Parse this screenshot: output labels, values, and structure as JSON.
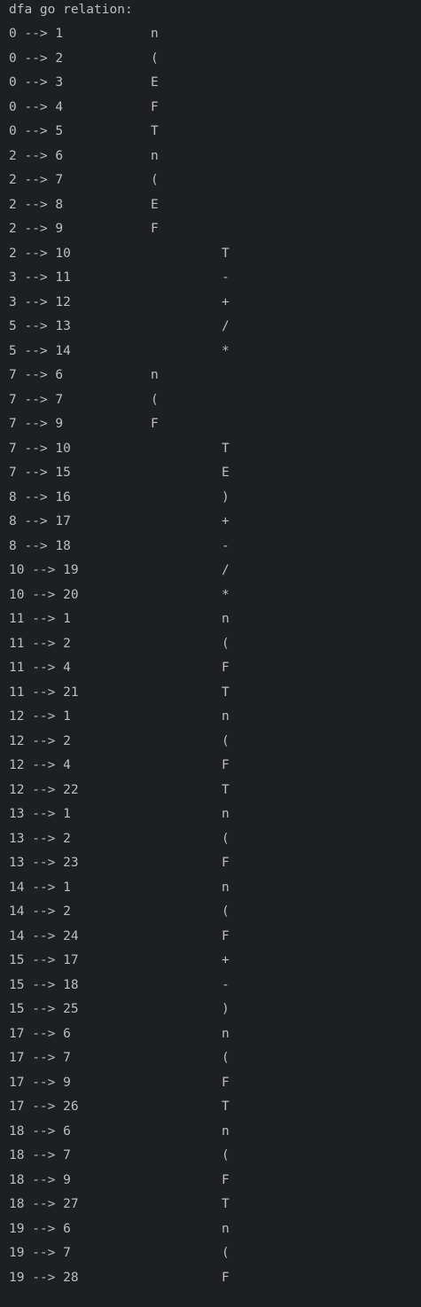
{
  "console": {
    "title": "dfa go relation:",
    "lines": [
      {
        "edge": "0 --> 1",
        "symbol": "n",
        "column": "a"
      },
      {
        "edge": "0 --> 2",
        "symbol": "(",
        "column": "a"
      },
      {
        "edge": "0 --> 3",
        "symbol": "E",
        "column": "a"
      },
      {
        "edge": "0 --> 4",
        "symbol": "F",
        "column": "a"
      },
      {
        "edge": "0 --> 5",
        "symbol": "T",
        "column": "a"
      },
      {
        "edge": "2 --> 6",
        "symbol": "n",
        "column": "a"
      },
      {
        "edge": "2 --> 7",
        "symbol": "(",
        "column": "a"
      },
      {
        "edge": "2 --> 8",
        "symbol": "E",
        "column": "a"
      },
      {
        "edge": "2 --> 9",
        "symbol": "F",
        "column": "a"
      },
      {
        "edge": "2 --> 10",
        "symbol": "T",
        "column": "b"
      },
      {
        "edge": "3 --> 11",
        "symbol": "-",
        "column": "b"
      },
      {
        "edge": "3 --> 12",
        "symbol": "+",
        "column": "b"
      },
      {
        "edge": "5 --> 13",
        "symbol": "/",
        "column": "b"
      },
      {
        "edge": "5 --> 14",
        "symbol": "*",
        "column": "b"
      },
      {
        "edge": "7 --> 6",
        "symbol": "n",
        "column": "a"
      },
      {
        "edge": "7 --> 7",
        "symbol": "(",
        "column": "a"
      },
      {
        "edge": "7 --> 9",
        "symbol": "F",
        "column": "a"
      },
      {
        "edge": "7 --> 10",
        "symbol": "T",
        "column": "b"
      },
      {
        "edge": "7 --> 15",
        "symbol": "E",
        "column": "b"
      },
      {
        "edge": "8 --> 16",
        "symbol": ")",
        "column": "b"
      },
      {
        "edge": "8 --> 17",
        "symbol": "+",
        "column": "b"
      },
      {
        "edge": "8 --> 18",
        "symbol": "-",
        "column": "b"
      },
      {
        "edge": "10 --> 19",
        "symbol": "/",
        "column": "b"
      },
      {
        "edge": "10 --> 20",
        "symbol": "*",
        "column": "b"
      },
      {
        "edge": "11 --> 1",
        "symbol": "n",
        "column": "b"
      },
      {
        "edge": "11 --> 2",
        "symbol": "(",
        "column": "b"
      },
      {
        "edge": "11 --> 4",
        "symbol": "F",
        "column": "b"
      },
      {
        "edge": "11 --> 21",
        "symbol": "T",
        "column": "b"
      },
      {
        "edge": "12 --> 1",
        "symbol": "n",
        "column": "b"
      },
      {
        "edge": "12 --> 2",
        "symbol": "(",
        "column": "b"
      },
      {
        "edge": "12 --> 4",
        "symbol": "F",
        "column": "b"
      },
      {
        "edge": "12 --> 22",
        "symbol": "T",
        "column": "b"
      },
      {
        "edge": "13 --> 1",
        "symbol": "n",
        "column": "b"
      },
      {
        "edge": "13 --> 2",
        "symbol": "(",
        "column": "b"
      },
      {
        "edge": "13 --> 23",
        "symbol": "F",
        "column": "b"
      },
      {
        "edge": "14 --> 1",
        "symbol": "n",
        "column": "b"
      },
      {
        "edge": "14 --> 2",
        "symbol": "(",
        "column": "b"
      },
      {
        "edge": "14 --> 24",
        "symbol": "F",
        "column": "b"
      },
      {
        "edge": "15 --> 17",
        "symbol": "+",
        "column": "b"
      },
      {
        "edge": "15 --> 18",
        "symbol": "-",
        "column": "b"
      },
      {
        "edge": "15 --> 25",
        "symbol": ")",
        "column": "b"
      },
      {
        "edge": "17 --> 6",
        "symbol": "n",
        "column": "b"
      },
      {
        "edge": "17 --> 7",
        "symbol": "(",
        "column": "b"
      },
      {
        "edge": "17 --> 9",
        "symbol": "F",
        "column": "b"
      },
      {
        "edge": "17 --> 26",
        "symbol": "T",
        "column": "b"
      },
      {
        "edge": "18 --> 6",
        "symbol": "n",
        "column": "b"
      },
      {
        "edge": "18 --> 7",
        "symbol": "(",
        "column": "b"
      },
      {
        "edge": "18 --> 9",
        "symbol": "F",
        "column": "b"
      },
      {
        "edge": "18 --> 27",
        "symbol": "T",
        "column": "b"
      },
      {
        "edge": "19 --> 6",
        "symbol": "n",
        "column": "b"
      },
      {
        "edge": "19 --> 7",
        "symbol": "(",
        "column": "b"
      },
      {
        "edge": "19 --> 28",
        "symbol": "F",
        "column": "b"
      }
    ]
  },
  "colors": {
    "background": "#1e1f22",
    "text": "#bcbec4"
  }
}
